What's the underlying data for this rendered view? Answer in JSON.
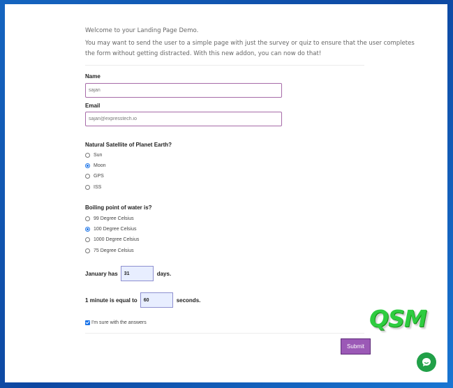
{
  "intro": {
    "heading": "Welcome to your Landing Page Demo.",
    "line1": "You may want to send the user to a simple page with just the survey or quiz to ensure that the user completes",
    "line2": "the form without getting distracted. With this new addon, you can now do that!"
  },
  "form": {
    "name_label": "Name",
    "name_value": "sajan",
    "email_label": "Email",
    "email_value": "sajan@expresstech.io",
    "q1": {
      "question": "Natural Satellite of Planet Earth?",
      "options": [
        "Sun",
        "Moon",
        "GPS",
        "ISS"
      ],
      "selected": "Moon"
    },
    "q2": {
      "question": "Boiling point of water is?",
      "options": [
        "99 Degree Celsius",
        "100 Degree Celsius",
        "1000 Degree Celsius",
        "75 Degree Celsius"
      ],
      "selected": "100 Degree Celsius"
    },
    "q3": {
      "prefix": "January has",
      "value": "31",
      "suffix": "days."
    },
    "q4": {
      "prefix": "1 minute is equal to",
      "value": "60",
      "suffix": "seconds."
    },
    "confirm_label": "I'm sure with the answers",
    "confirm_checked": true,
    "submit_label": "Submit"
  },
  "logo": {
    "text": "QSM",
    "color": "#2ecc40"
  },
  "chat": {
    "icon": "chat-bubble-icon",
    "color": "#21a048"
  },
  "colors": {
    "input_border": "#a66aa8",
    "fill_bg": "#e8eeff",
    "submit_bg": "#9b59b6",
    "background": "#1565c0"
  }
}
